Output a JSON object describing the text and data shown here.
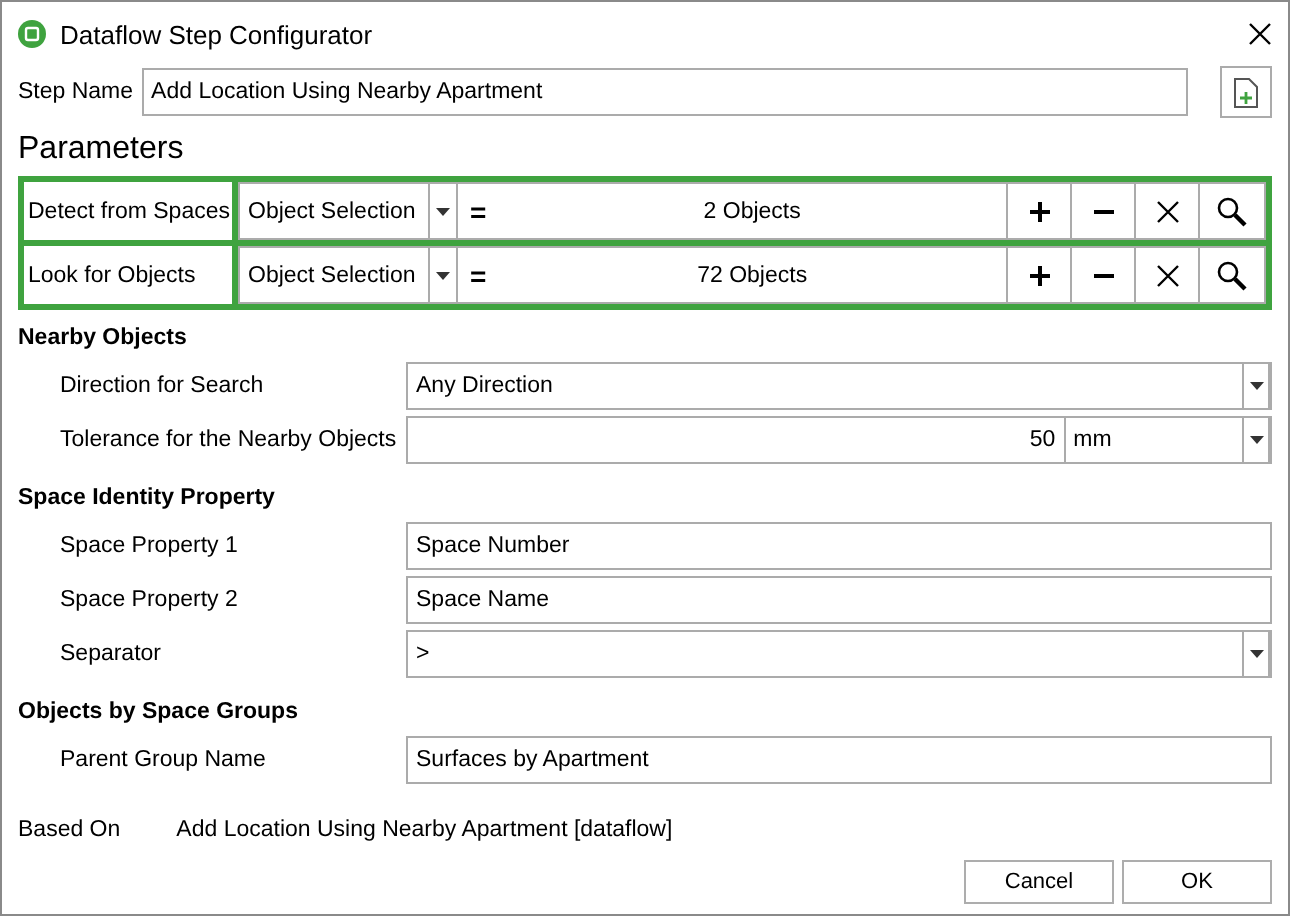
{
  "window": {
    "title": "Dataflow Step Configurator"
  },
  "step_name": {
    "label": "Step Name",
    "value": "Add Location Using Nearby Apartment"
  },
  "parameters": {
    "heading": "Parameters",
    "rows": [
      {
        "label": "Detect from Spaces",
        "selector": "Object Selection",
        "operator": "=",
        "value": "2 Objects"
      },
      {
        "label": "Look for Objects",
        "selector": "Object Selection",
        "operator": "=",
        "value": "72 Objects"
      }
    ]
  },
  "sections": [
    {
      "heading": "Nearby Objects",
      "fields": [
        {
          "kind": "dropdown",
          "label": "Direction for Search",
          "value": "Any Direction"
        },
        {
          "kind": "number_unit",
          "label": "Tolerance for the Nearby Objects",
          "value": "50",
          "unit": "mm"
        }
      ]
    },
    {
      "heading": "Space Identity Property",
      "fields": [
        {
          "kind": "text",
          "label": "Space Property 1",
          "value": "Space Number"
        },
        {
          "kind": "text",
          "label": "Space Property 2",
          "value": "Space Name"
        },
        {
          "kind": "dropdown",
          "label": "Separator",
          "value": ">"
        }
      ]
    },
    {
      "heading": "Objects by Space Groups",
      "fields": [
        {
          "kind": "text",
          "label": "Parent Group Name",
          "value": "Surfaces by Apartment"
        }
      ]
    }
  ],
  "based_on": {
    "label": "Based On",
    "value": "Add Location Using Nearby Apartment [dataflow]"
  },
  "buttons": [
    "Cancel",
    "OK"
  ]
}
